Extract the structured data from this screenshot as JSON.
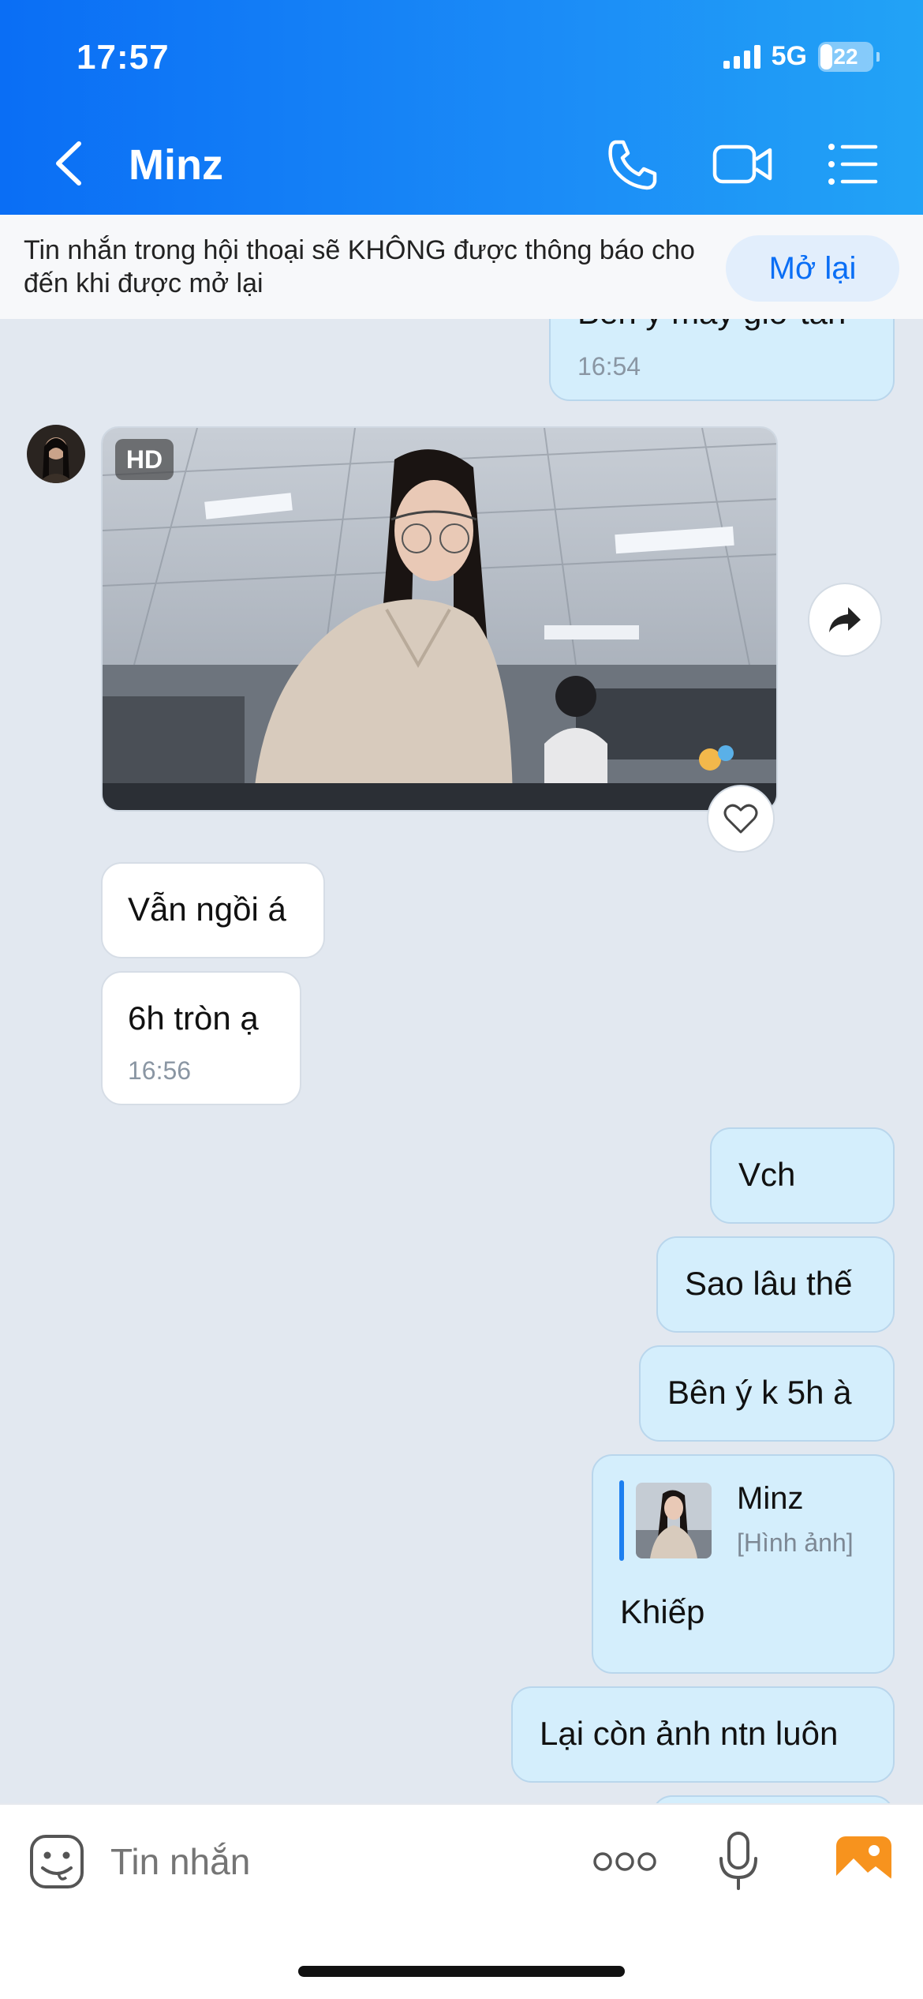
{
  "status_bar": {
    "time": "17:57",
    "network": "5G",
    "battery": "22"
  },
  "header": {
    "title": "Minz"
  },
  "mute_banner": {
    "text": "Tin nhắn trong hội thoại sẽ KHÔNG được thông báo cho đến khi được mở lại",
    "button": "Mở lại"
  },
  "messages": {
    "m0": {
      "text": "Bên ý mấy giờ tan",
      "time": "16:54"
    },
    "photo": {
      "badge": "HD"
    },
    "m1": {
      "text": "Vẫn ngồi á"
    },
    "m2": {
      "text": "6h tròn ạ",
      "time": "16:56"
    },
    "m3": {
      "text": "Vch"
    },
    "m4": {
      "text": "Sao lâu thế"
    },
    "m5": {
      "text": "Bên ý k 5h à"
    },
    "m6": {
      "quote_name": "Minz",
      "quote_sub": "[Hình ảnh]",
      "text": "Khiếp"
    },
    "m7": {
      "text": "Lại còn ảnh ntn luôn"
    }
  },
  "composer": {
    "placeholder": "Tin nhắn"
  },
  "colors": {
    "accent": "#0a6ef5",
    "outgoing_bubble": "#d4eefc",
    "incoming_bubble": "#ffffff",
    "background": "#e2e8f0"
  }
}
